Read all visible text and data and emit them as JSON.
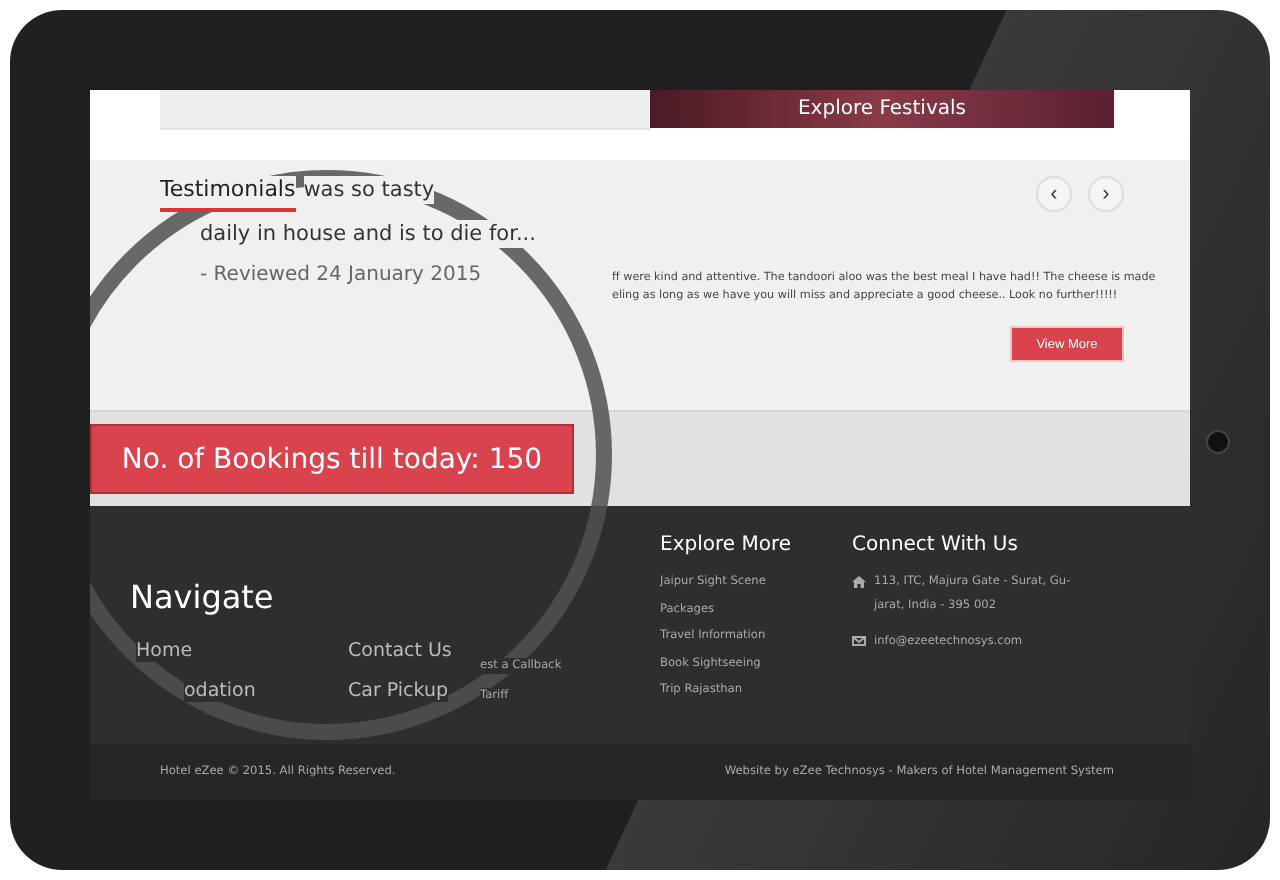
{
  "top_section": {
    "banner": {
      "label": "Explore Festivals"
    }
  },
  "testimonials": {
    "title": "Testimonials",
    "nav_buttons": [
      "‹",
      "›"
    ],
    "magnified_lines": [
      "was so tasty",
      "daily in house and is to die for..."
    ],
    "reviewed": "- Reviewed 24 January 2015",
    "review_lines": [
      "ff were kind and attentive. The tandoori aloo was the best meal I have had!! The cheese is made",
      "eling as long as we have you will miss and appreciate a good cheese.. Look no further!!!!!"
    ],
    "view_more": "View More"
  },
  "bookings": {
    "label": "No. of Bookings till today: 150"
  },
  "footer": {
    "navigate": {
      "title": "Navigate",
      "links": [
        "Home",
        "Contact Us",
        "odation",
        "Car Pickup"
      ]
    },
    "partial_links": [
      "est a Callback",
      "Tariff"
    ],
    "explore_more": {
      "title": "Explore More",
      "links": [
        "Jaipur Sight Scene",
        "Packages",
        "Travel Information",
        "Book Sightseeing",
        "Trip Rajasthan"
      ]
    },
    "connect": {
      "title": "Connect With Us",
      "address": "113, ITC, Majura Gate - Surat, Gu-jarat, India - 395 002",
      "email": "info@ezeetechnosys.com"
    }
  },
  "bottom_bar": {
    "copyright": "Hotel eZee © 2015. All Rights Reserved.",
    "credit": "Website by eZee Technosys - Makers of Hotel Management System"
  }
}
